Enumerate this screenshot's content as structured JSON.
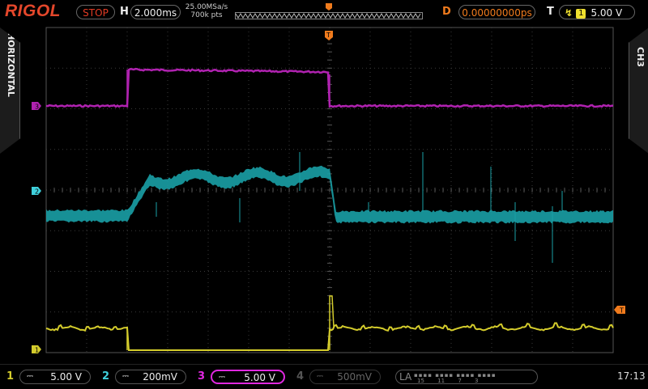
{
  "brand": "RIGOL",
  "run_state": "STOP",
  "horizontal": {
    "label": "H",
    "timebase": "2.000ms",
    "sample_rate": "25.00MSa/s",
    "memory_depth": "700k pts",
    "delay_label": "D",
    "delay": "0.00000000ps",
    "side_tab": "HORIZONTAL"
  },
  "trigger": {
    "label": "T",
    "edge_symbol": "↯",
    "source": "1",
    "level": "5.00 V",
    "marker": "T"
  },
  "active_channel_tab": "CH3",
  "channels": [
    {
      "num": "1",
      "coupling_icon": "dc-coupling-icon",
      "coupling": "⎓",
      "scale": "5.00 V",
      "color": "#d4cc2c",
      "active": true
    },
    {
      "num": "2",
      "coupling_icon": "dc-coupling-icon",
      "coupling": "⎓",
      "scale": "200mV",
      "color": "#3fd0dc",
      "active": true
    },
    {
      "num": "3",
      "coupling_icon": "dc-coupling-icon",
      "coupling": "⎓",
      "scale": "5.00 V",
      "color": "#e028e0",
      "active": true,
      "selected": true
    },
    {
      "num": "4",
      "coupling_icon": "dc-coupling-icon",
      "coupling": "⎓",
      "scale": "500mV",
      "color": "#444444",
      "active": false
    }
  ],
  "logic_analyzer": {
    "label": "LA",
    "bits": "▪▪▪▪ ▪▪▪▪ ▪▪▪▪ ▪▪▪▪",
    "bit_labels": [
      "15",
      "11",
      "7",
      "3"
    ]
  },
  "clock": "17:13",
  "colors": {
    "ch1": "#d4cc2c",
    "ch2": "#1aa0a6",
    "ch3": "#b022b0",
    "trigger": "#f07b1d",
    "grid": "#3a3a3a"
  }
}
